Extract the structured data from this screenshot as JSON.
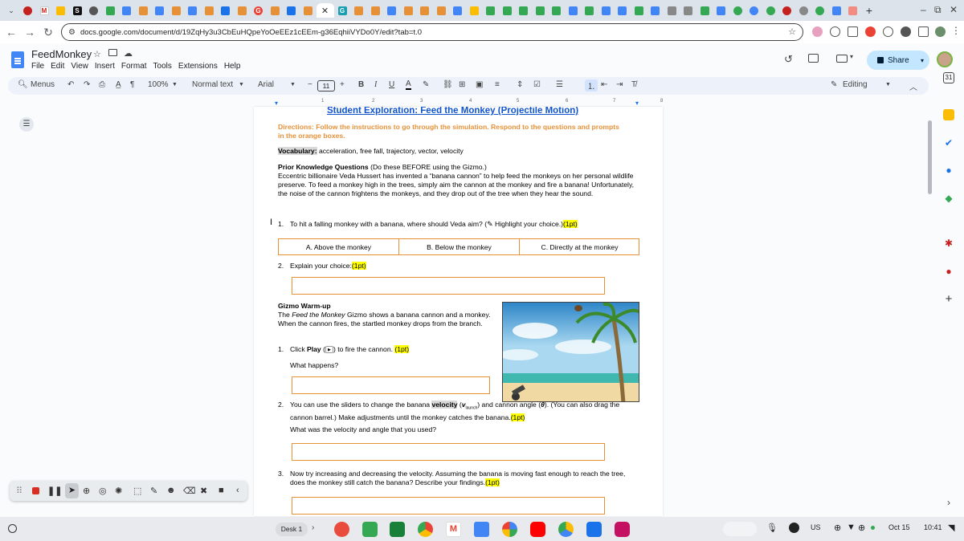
{
  "browser": {
    "url": "docs.google.com/document/d/19ZqHy3u3CbEuHQpeYoOeEEz1cEEm-g36EqhiiVYDo0Y/edit?tab=t.0",
    "window_controls": [
      "–",
      "⧉",
      "✕"
    ]
  },
  "docs": {
    "title": "FeedMonkey",
    "menus": [
      "File",
      "Edit",
      "View",
      "Insert",
      "Format",
      "Tools",
      "Extensions",
      "Help"
    ],
    "share_label": "Share",
    "toolbar": {
      "search_menus": "Menus",
      "zoom": "100%",
      "style": "Normal text",
      "font": "Arial",
      "font_size": "11",
      "mode": "Editing"
    },
    "ruler_numbers": [
      "1",
      "2",
      "3",
      "4",
      "5",
      "6",
      "7",
      "8"
    ]
  },
  "document": {
    "heading": "Student Exploration: Feed the Monkey (Projectile Motion)",
    "directions": "Directions: Follow the instructions to go through the simulation. Respond to the questions and prompts in the orange boxes.",
    "vocab_label": "Vocabulary:",
    "vocab_terms": " acceleration, free fall, trajectory, vector, velocity",
    "prior_heading": "Prior Knowledge Questions",
    "prior_note": " (Do these BEFORE using the Gizmo.)",
    "prior_body": "Eccentric billionaire Veda Hussert has invented a “banana cannon” to help feed the monkeys on her personal wildlife preserve. To feed a monkey high in the trees, simply aim the cannon at the monkey and fire a banana! Unfortunately, the noise of the cannon frightens the monkeys, and they drop out of the tree when they hear the sound.",
    "q1_num": "1.",
    "q1_text": "To hit a falling monkey with a banana, where should Veda aim? (",
    "q1_text2": " Highlight your choice.)",
    "points": "(1pt)",
    "choices": [
      "A. Above the monkey",
      "B. Below the monkey",
      "C. Directly at the monkey"
    ],
    "q2_num": "2.",
    "q2_text": "Explain your choice:",
    "warmup_heading": "Gizmo Warm-up",
    "warmup_pre": "The ",
    "warmup_italic": "Feed the Monkey",
    "warmup_rest": " Gizmo shows a banana cannon and a monkey. When the cannon fires, the startled monkey drops from the branch.",
    "w1_num": "1.",
    "w1_pre": "Click ",
    "w1_bold": "Play",
    "w1_mid": " (",
    "w1_post": ") to fire the cannon. ",
    "w1_sub": "What happens?",
    "w2_num": "2.",
    "w2_pre": "You can use the sliders to change the banana ",
    "w2_bold": "velocity",
    "w2_paren": " (",
    "w2_v": "v",
    "w2_vsub": "launch",
    "w2_mid": ") and cannon angle (",
    "w2_theta": "θ",
    "w2_rest": "). (You can also drag the cannon barrel.) Make adjustments until the monkey catches the banana.",
    "w2_sub": "What was the velocity and angle that you used?",
    "w3_num": "3.",
    "w3_text": "Now try increasing and decreasing the velocity. Assuming the banana is moving fast enough to reach the tree, does the monkey still catch the banana? Describe your findings."
  },
  "taskbar": {
    "desk": "Desk 1",
    "locale": "US",
    "date": "Oct 15",
    "time": "10:41"
  },
  "colors": {
    "orange": "#e69138",
    "heading_blue": "#1155cc",
    "highlight": "#ffff00",
    "share_bg": "#c2e7ff"
  }
}
